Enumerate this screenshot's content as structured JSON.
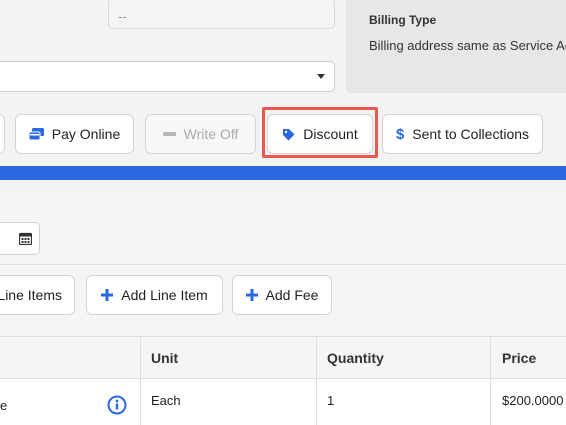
{
  "top": {
    "disabled_field_value": "--",
    "billing_title": "Billing Type",
    "billing_text": "Billing address same as Service Add"
  },
  "actions": {
    "pay_online": "Pay Online",
    "write_off": "Write Off",
    "discount": "Discount",
    "sent_to_collections": "Sent to Collections",
    "dollar_symbol": "$"
  },
  "line_items_toolbar": {
    "line_items": "Line Items",
    "add_line_item": "Add Line Item",
    "add_fee": "Add Fee"
  },
  "table": {
    "headers": [
      "Unit",
      "Quantity",
      "Price"
    ],
    "rows": [
      {
        "name_tail": "e",
        "unit": "Each",
        "quantity": "1",
        "price": "$200.0000"
      }
    ]
  },
  "colors": {
    "accent_blue": "#2b67e0",
    "highlight_red": "#e8584c"
  }
}
